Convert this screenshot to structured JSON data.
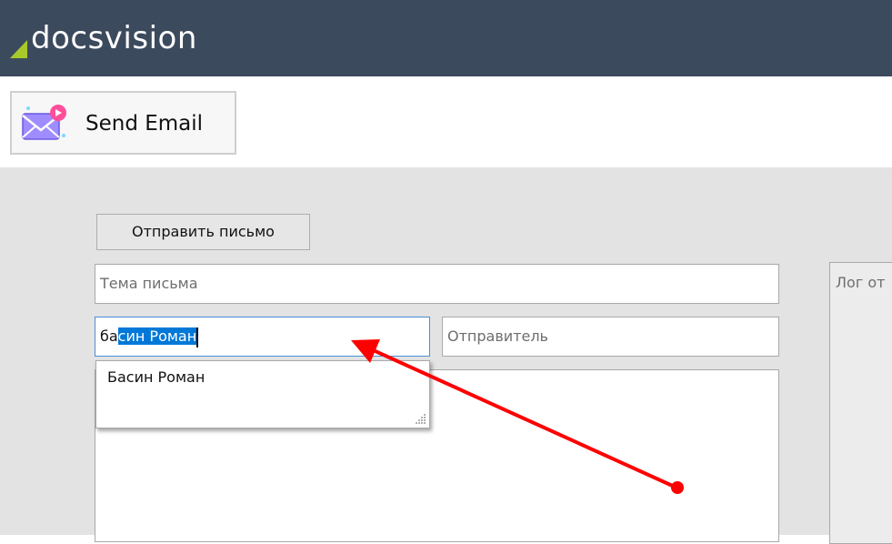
{
  "header": {
    "logo_text": "docsvision",
    "logo_accent_color": "#a8c92b",
    "bar_color": "#3c4a5e"
  },
  "toolbar": {
    "send_email_label": "Send Email",
    "send_email_icon": "envelope-notification-icon"
  },
  "form": {
    "send_button_label": "Отправить письмо",
    "subject_placeholder": "Тема письма",
    "recipient_value_typed": "ба",
    "recipient_value_selected": "син Роман",
    "sender_placeholder": "Отправитель",
    "autocomplete_options": [
      "Басин Роман"
    ],
    "log_label": "Лог от"
  },
  "annotation": {
    "arrow_color": "#ff0000"
  }
}
